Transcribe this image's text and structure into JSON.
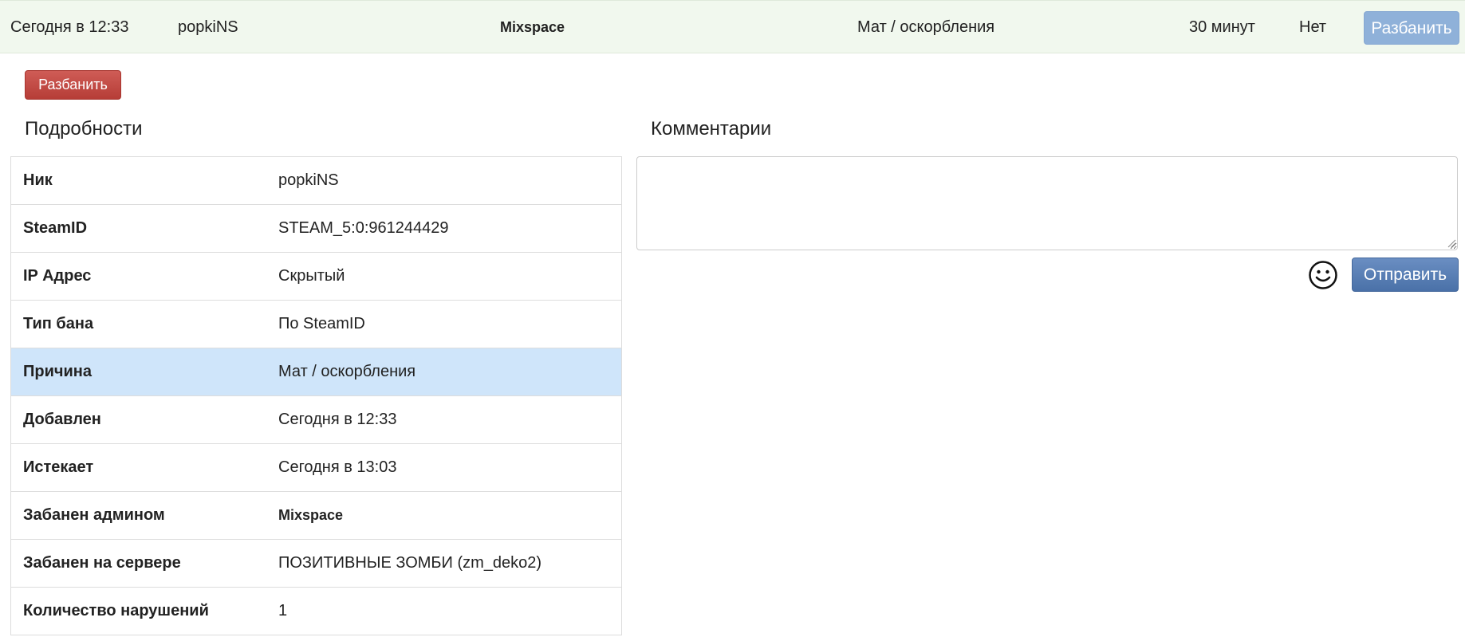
{
  "summary_row": {
    "date": "Сегодня в 12:33",
    "nick": "popkiNS",
    "admin": "Mixspace",
    "reason": "Мат / оскорбления",
    "duration": "30 минут",
    "expired": "Нет",
    "unban_label": "Разбанить",
    "background_color": "#f1f8ee"
  },
  "actions": {
    "unban_label": "Разбанить",
    "unban_color": "#c1453f"
  },
  "details": {
    "title": "Подробности",
    "rows": [
      {
        "key": "Ник",
        "value": "popkiNS"
      },
      {
        "key": "SteamID",
        "value": "STEAM_5:0:961244429"
      },
      {
        "key": "IP Адрес",
        "value": "Скрытый"
      },
      {
        "key": "Тип бана",
        "value": "По SteamID"
      },
      {
        "key": "Причина",
        "value": "Мат / оскорбления"
      },
      {
        "key": "Добавлен",
        "value": "Сегодня в 12:33"
      },
      {
        "key": "Истекает",
        "value": "Сегодня в 13:03"
      },
      {
        "key": "Забанен админом",
        "value": "Mixspace"
      },
      {
        "key": "Забанен на сервере",
        "value": "ПОЗИТИВНЫЕ ЗОМБИ (zm_deko2)"
      },
      {
        "key": "Количество нарушений",
        "value": "1"
      }
    ],
    "highlight_color": "#cfe5fa"
  },
  "comments": {
    "title": "Комментарии",
    "input_value": "",
    "emoji_icon": "smiley-icon",
    "send_label": "Отправить",
    "send_color": "#5277ad"
  }
}
